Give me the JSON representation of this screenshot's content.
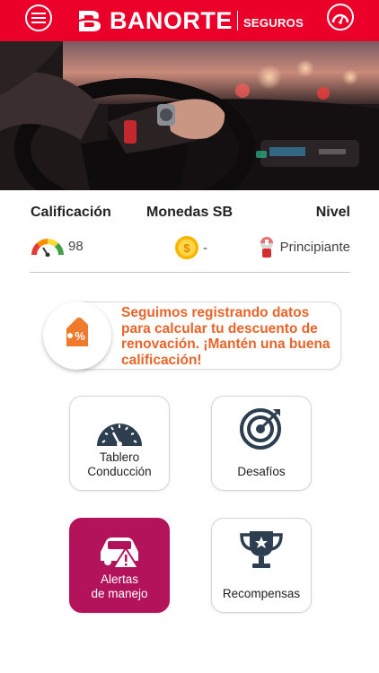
{
  "header": {
    "brand": "BANORTE",
    "brand_sub": "SEGUROS",
    "menu_icon": "menu-icon",
    "speed_icon": "speedometer-icon",
    "color": "#eb0029"
  },
  "stats": {
    "labels": {
      "rating": "Calificación",
      "coins": "Monedas SB",
      "level": "Nivel"
    },
    "values": {
      "rating": "98",
      "coins": "-",
      "level": "Principiante"
    }
  },
  "banner": {
    "text": "Seguimos registrando datos para calcular tu descuento de renovación. ¡Mantén una buena calificación!",
    "icon": "tag-discount-icon",
    "color": "#e8642a"
  },
  "tiles": [
    {
      "label_1": "Tablero",
      "label_2": "Conducción",
      "icon": "dashboard-gauge-icon"
    },
    {
      "label_1": "Desafíos",
      "icon": "target-icon"
    },
    {
      "label_1": "Alertas",
      "label_2": "de manejo",
      "icon": "car-alert-icon",
      "active_color": "#b3135b"
    },
    {
      "label_1": "Recompensas",
      "icon": "trophy-icon"
    }
  ]
}
